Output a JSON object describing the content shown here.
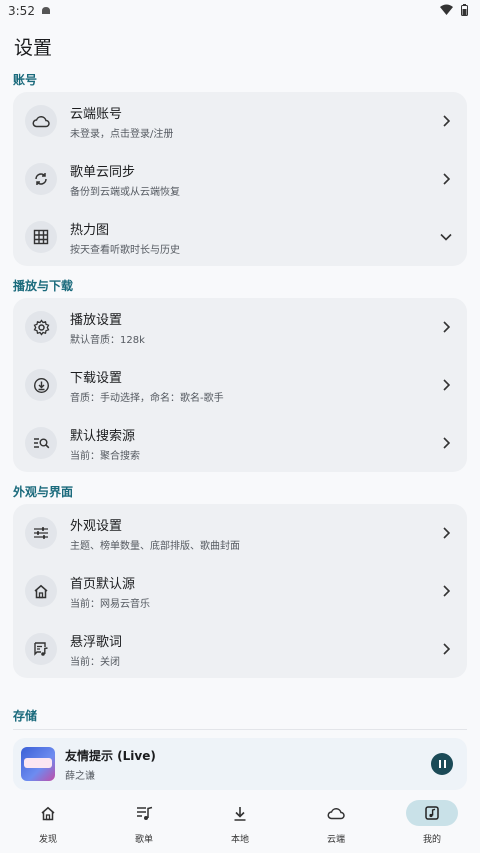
{
  "status_bar": {
    "time": "3:52"
  },
  "page": {
    "title": "设置"
  },
  "sections": [
    {
      "title": "账号",
      "items": [
        {
          "icon": "cloud-icon",
          "title": "云端账号",
          "subtitle": "未登录，点击登录/注册",
          "action": "chevron-right"
        },
        {
          "icon": "sync-icon",
          "title": "歌单云同步",
          "subtitle": "备份到云端或从云端恢复",
          "action": "chevron-right"
        },
        {
          "icon": "grid-icon",
          "title": "热力图",
          "subtitle": "按天查看听歌时长与历史",
          "action": "chevron-down"
        }
      ]
    },
    {
      "title": "播放与下载",
      "items": [
        {
          "icon": "gear-icon",
          "title": "播放设置",
          "subtitle": "默认音质：128k",
          "action": "chevron-right"
        },
        {
          "icon": "download-circle-icon",
          "title": "下载设置",
          "subtitle": "音质：手动选择，命名：歌名-歌手",
          "action": "chevron-right"
        },
        {
          "icon": "search-list-icon",
          "title": "默认搜索源",
          "subtitle": "当前：聚合搜索",
          "action": "chevron-right"
        }
      ]
    },
    {
      "title": "外观与界面",
      "items": [
        {
          "icon": "sliders-icon",
          "title": "外观设置",
          "subtitle": "主题、榜单数量、底部排版、歌曲封面",
          "action": "chevron-right"
        },
        {
          "icon": "home-icon",
          "title": "首页默认源",
          "subtitle": "当前：网易云音乐",
          "action": "chevron-right"
        },
        {
          "icon": "lyrics-icon",
          "title": "悬浮歌词",
          "subtitle": "当前：关闭",
          "action": "chevron-right"
        }
      ]
    },
    {
      "title": "存储",
      "items": []
    }
  ],
  "player": {
    "song": "友情提示 (Live)",
    "artist": "薛之谦",
    "state": "playing"
  },
  "nav": [
    {
      "icon": "home-icon",
      "label": "发现",
      "active": false
    },
    {
      "icon": "music-list-icon",
      "label": "歌单",
      "active": false
    },
    {
      "icon": "download-icon",
      "label": "本地",
      "active": false
    },
    {
      "icon": "cloud-icon",
      "label": "云端",
      "active": false
    },
    {
      "icon": "music-folder-icon",
      "label": "我的",
      "active": true
    }
  ],
  "colors": {
    "accent": "#1a6a7c",
    "card_bg": "#eef0f3",
    "page_bg": "#f8f9fb"
  }
}
